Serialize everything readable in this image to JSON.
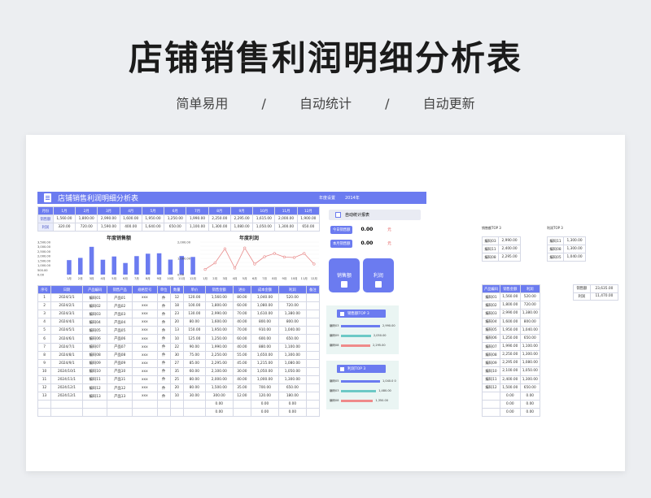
{
  "hero": {
    "title": "店铺销售利润明细分析表",
    "tags": [
      "简单易用",
      "/",
      "自动统计",
      "/",
      "自动更新"
    ]
  },
  "banner": {
    "title": "店铺销售利润明细分析表",
    "year_label": "年度设置",
    "year": "2014年"
  },
  "months": {
    "header": [
      "月份",
      "1月",
      "2月",
      "3月",
      "4月",
      "5月",
      "6月",
      "7月",
      "8月",
      "9月",
      "10月",
      "11月",
      "12月"
    ],
    "sales_label": "销售额",
    "sales": [
      "1,560.00",
      "1,800.00",
      "2,990.00",
      "1,600.00",
      "1,950.00",
      "1,250.00",
      "1,990.00",
      "2,250.00",
      "2,295.00",
      "1,615.00",
      "2,000.00",
      "1,900.00"
    ],
    "profit_label": "利润",
    "profit": [
      "320.00",
      "720.00",
      "1,590.00",
      "400.00",
      "1,640.00",
      "650.00",
      "1,100.00",
      "1,300.00",
      "1,080.00",
      "1,050.00",
      "1,300.00",
      "650.00"
    ]
  },
  "chart_data": [
    {
      "type": "bar",
      "title": "年度销售额",
      "categories": [
        "1月",
        "2月",
        "3月",
        "4月",
        "5月",
        "6月",
        "7月",
        "8月",
        "9月",
        "10月",
        "11月",
        "12月"
      ],
      "values": [
        1560,
        1800,
        2990,
        1600,
        1950,
        1250,
        1990,
        2250,
        2295,
        1615,
        2000,
        1900
      ],
      "ylim": [
        0,
        3500
      ],
      "yticks": [
        "3,500.00",
        "3,000.00",
        "2,500.00",
        "2,000.00",
        "1,500.00",
        "1,000.00",
        "500.00",
        "0.00"
      ],
      "color": "#6b7bf0"
    },
    {
      "type": "line",
      "title": "年度利润",
      "categories": [
        "1月",
        "2月",
        "3月",
        "4月",
        "5月",
        "6月",
        "7月",
        "8月",
        "9月",
        "10月",
        "11月",
        "12月"
      ],
      "values": [
        320,
        720,
        1590,
        400,
        1640,
        650,
        1100,
        1300,
        1080,
        1050,
        1300,
        650
      ],
      "ylim": [
        0,
        2000
      ],
      "yticks": [
        "2,000.00",
        "1,000.00",
        "0.00"
      ],
      "color": "#e88a8a"
    }
  ],
  "detail": {
    "header": [
      "序号",
      "日期",
      "产品编码",
      "销售产品",
      "规格型号",
      "单位",
      "数量",
      "单价",
      "销售金额",
      "进价",
      "成本金额",
      "利润",
      "备注"
    ],
    "rows": [
      [
        "1",
        "2024/1/1",
        "编码01",
        "产品01",
        "xxx",
        "件",
        "12",
        "120.00",
        "1,560.00",
        "80.00",
        "1,040.00",
        "520.00",
        ""
      ],
      [
        "2",
        "2024/2/1",
        "编码02",
        "产品02",
        "xxx",
        "件",
        "18",
        "100.00",
        "1,800.00",
        "60.00",
        "1,080.00",
        "720.00",
        ""
      ],
      [
        "3",
        "2024/3/1",
        "编码03",
        "产品03",
        "xxx",
        "件",
        "23",
        "130.00",
        "2,990.00",
        "70.00",
        "1,610.00",
        "1,380.00",
        ""
      ],
      [
        "4",
        "2024/4/1",
        "编码04",
        "产品04",
        "xxx",
        "件",
        "20",
        "80.00",
        "1,600.00",
        "40.00",
        "800.00",
        "800.00",
        ""
      ],
      [
        "5",
        "2024/5/1",
        "编码05",
        "产品05",
        "xxx",
        "件",
        "13",
        "150.00",
        "1,950.00",
        "70.00",
        "910.00",
        "1,040.00",
        ""
      ],
      [
        "6",
        "2024/6/1",
        "编码06",
        "产品06",
        "xxx",
        "件",
        "10",
        "125.00",
        "1,250.00",
        "60.00",
        "600.00",
        "650.00",
        ""
      ],
      [
        "7",
        "2024/7/1",
        "编码07",
        "产品07",
        "xxx",
        "件",
        "22",
        "90.00",
        "1,990.00",
        "40.00",
        "880.00",
        "1,100.00",
        ""
      ],
      [
        "8",
        "2024/8/1",
        "编码08",
        "产品08",
        "xxx",
        "件",
        "30",
        "75.00",
        "2,250.00",
        "55.00",
        "1,650.00",
        "1,300.00",
        ""
      ],
      [
        "9",
        "2024/9/1",
        "编码09",
        "产品09",
        "xxx",
        "件",
        "27",
        "85.00",
        "2,295.00",
        "45.00",
        "1,215.00",
        "1,080.00",
        ""
      ],
      [
        "10",
        "2024/10/1",
        "编码10",
        "产品10",
        "xxx",
        "件",
        "35",
        "60.00",
        "2,100.00",
        "30.00",
        "1,050.00",
        "1,050.00",
        ""
      ],
      [
        "11",
        "2024/11/1",
        "编码11",
        "产品11",
        "xxx",
        "件",
        "25",
        "80.00",
        "2,000.00",
        "40.00",
        "1,000.00",
        "1,300.00",
        ""
      ],
      [
        "12",
        "2024/12/1",
        "编码12",
        "产品12",
        "xxx",
        "件",
        "20",
        "80.00",
        "1,500.00",
        "35.00",
        "700.00",
        "650.00",
        ""
      ],
      [
        "13",
        "2024/12/1",
        "编码13",
        "产品13",
        "xxx",
        "件",
        "10",
        "30.00",
        "300.00",
        "12.00",
        "120.00",
        "180.00",
        ""
      ],
      [
        "",
        "",
        "",
        "",
        "",
        "",
        "",
        "",
        "0.00",
        "",
        "0.00",
        "0.00",
        ""
      ],
      [
        "",
        "",
        "",
        "",
        "",
        "",
        "",
        "",
        "0.00",
        "",
        "0.00",
        "0.00",
        ""
      ]
    ]
  },
  "stats": {
    "header": "自动统计报表",
    "today_label": "今日销售额",
    "today_value": "0.00",
    "today_unit": "元",
    "month_label": "本月销售额",
    "month_value": "0.00",
    "month_unit": "元",
    "btn_sales": "销售额",
    "btn_profit": "利润"
  },
  "top_sales": {
    "title": "销售额TOP 3",
    "items": [
      {
        "label": "编码03",
        "value": "2,990.00",
        "pct": 1.0,
        "color": "#6b7bf0"
      },
      {
        "label": "编码09",
        "value": "2,050.00",
        "pct": 0.77,
        "color": "#6cc9c6"
      },
      {
        "label": "编码08",
        "value": "2,295.00",
        "pct": 0.75,
        "color": "#ef8a8a"
      }
    ]
  },
  "top_profit": {
    "title": "利润TOP 3",
    "items": [
      {
        "label": "编码05",
        "value": "1,040.0\n0",
        "pct": 1.0,
        "color": "#6b7bf0"
      },
      {
        "label": "编码03",
        "value": "1,480.00",
        "pct": 0.9,
        "color": "#6cc9c6"
      },
      {
        "label": "编码08",
        "value": "1,350.00",
        "pct": 0.82,
        "color": "#ef8a8a"
      }
    ]
  },
  "top_tables": {
    "sales_title": "销售额TOP 3",
    "sales_rows": [
      [
        "编码03",
        "2,990.00"
      ],
      [
        "编码11",
        "2,400.00"
      ],
      [
        "编码08",
        "2,295.00"
      ]
    ],
    "profit_title": "利润TOP 3",
    "profit_rows": [
      [
        "编码11",
        "1,300.00"
      ],
      [
        "编码08",
        "1,300.00"
      ],
      [
        "编码05",
        "1,040.00"
      ]
    ]
  },
  "right_table": {
    "header": [
      "产品编码",
      "销售金额",
      "利润"
    ],
    "rows": [
      [
        "编码01",
        "1,560.00",
        "520.00"
      ],
      [
        "编码02",
        "1,800.00",
        "720.00"
      ],
      [
        "编码03",
        "2,990.00",
        "1,380.00"
      ],
      [
        "编码04",
        "1,600.00",
        "800.00"
      ],
      [
        "编码05",
        "1,950.00",
        "1,040.00"
      ],
      [
        "编码06",
        "1,250.00",
        "650.00"
      ],
      [
        "编码07",
        "1,990.00",
        "1,100.00"
      ],
      [
        "编码08",
        "2,250.00",
        "1,300.00"
      ],
      [
        "编码09",
        "2,295.00",
        "1,080.00"
      ],
      [
        "编码10",
        "2,100.00",
        "1,050.00"
      ],
      [
        "编码11",
        "2,400.00",
        "1,300.00"
      ],
      [
        "编码12",
        "1,500.00",
        "650.00"
      ],
      [
        "",
        "0.00",
        "0.00"
      ],
      [
        "",
        "0.00",
        "0.00"
      ],
      [
        "",
        "0.00",
        "0.00"
      ]
    ]
  },
  "sum_table": {
    "rows": [
      [
        "销售额",
        "23,635.00"
      ],
      [
        "利润",
        "11,470.00"
      ]
    ]
  }
}
